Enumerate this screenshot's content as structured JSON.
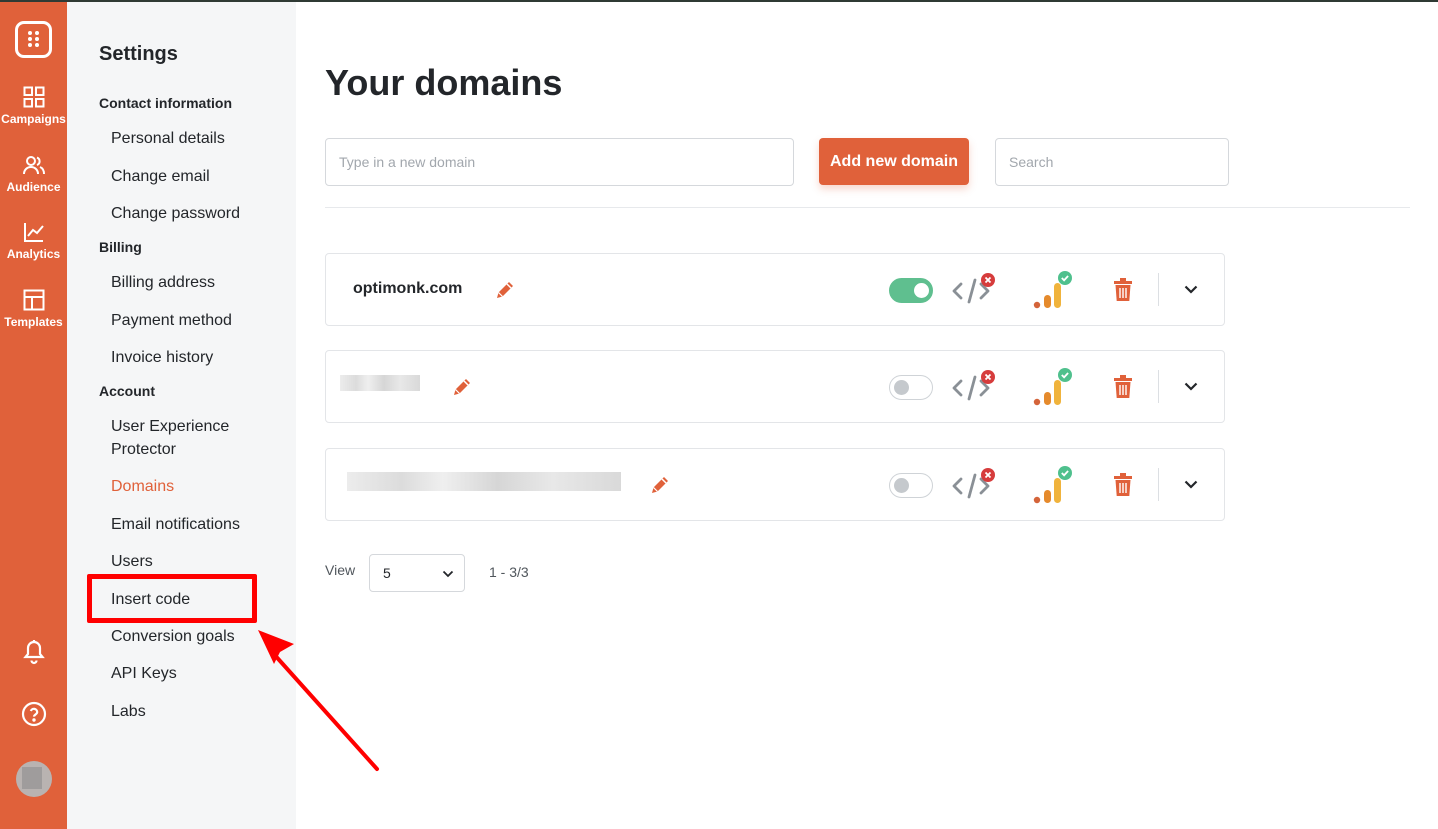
{
  "rail": {
    "items": [
      {
        "label": "Campaigns",
        "icon": "grid-icon"
      },
      {
        "label": "Audience",
        "icon": "users-icon"
      },
      {
        "label": "Analytics",
        "icon": "chart-line-icon"
      },
      {
        "label": "Templates",
        "icon": "layout-icon"
      }
    ],
    "bottom_icons": [
      "bell-icon",
      "help-icon",
      "avatar"
    ]
  },
  "sidebar": {
    "title": "Settings",
    "groups": [
      {
        "label": "Contact information",
        "items": [
          "Personal details",
          "Change email",
          "Change password"
        ]
      },
      {
        "label": "Billing",
        "items": [
          "Billing address",
          "Payment method",
          "Invoice history"
        ]
      },
      {
        "label": "Account",
        "items": [
          "User Experience Protector",
          "Domains",
          "Email notifications",
          "Users",
          "Insert code",
          "Conversion goals",
          "API Keys",
          "Labs"
        ]
      }
    ],
    "active_item": "Domains"
  },
  "main": {
    "title": "Your domains",
    "domain_input": {
      "placeholder": "Type in a new domain",
      "value": ""
    },
    "add_button": "Add new domain",
    "search": {
      "placeholder": "Search",
      "value": ""
    },
    "domains": [
      {
        "name": "optimonk.com",
        "enabled": true,
        "code_status": "error",
        "stats_status": "ok"
      },
      {
        "name": "",
        "enabled": false,
        "code_status": "error",
        "stats_status": "ok"
      },
      {
        "name": "",
        "enabled": false,
        "code_status": "error",
        "stats_status": "ok"
      }
    ],
    "pagination": {
      "view_label": "View",
      "page_size": "5",
      "range": "1 - 3/3"
    }
  },
  "colors": {
    "brand": "#e0613a",
    "toggle_on": "#5fbf8f",
    "error_badge": "#d63c3c",
    "ok_badge": "#4fc08d",
    "annotation": "#ff0000"
  }
}
